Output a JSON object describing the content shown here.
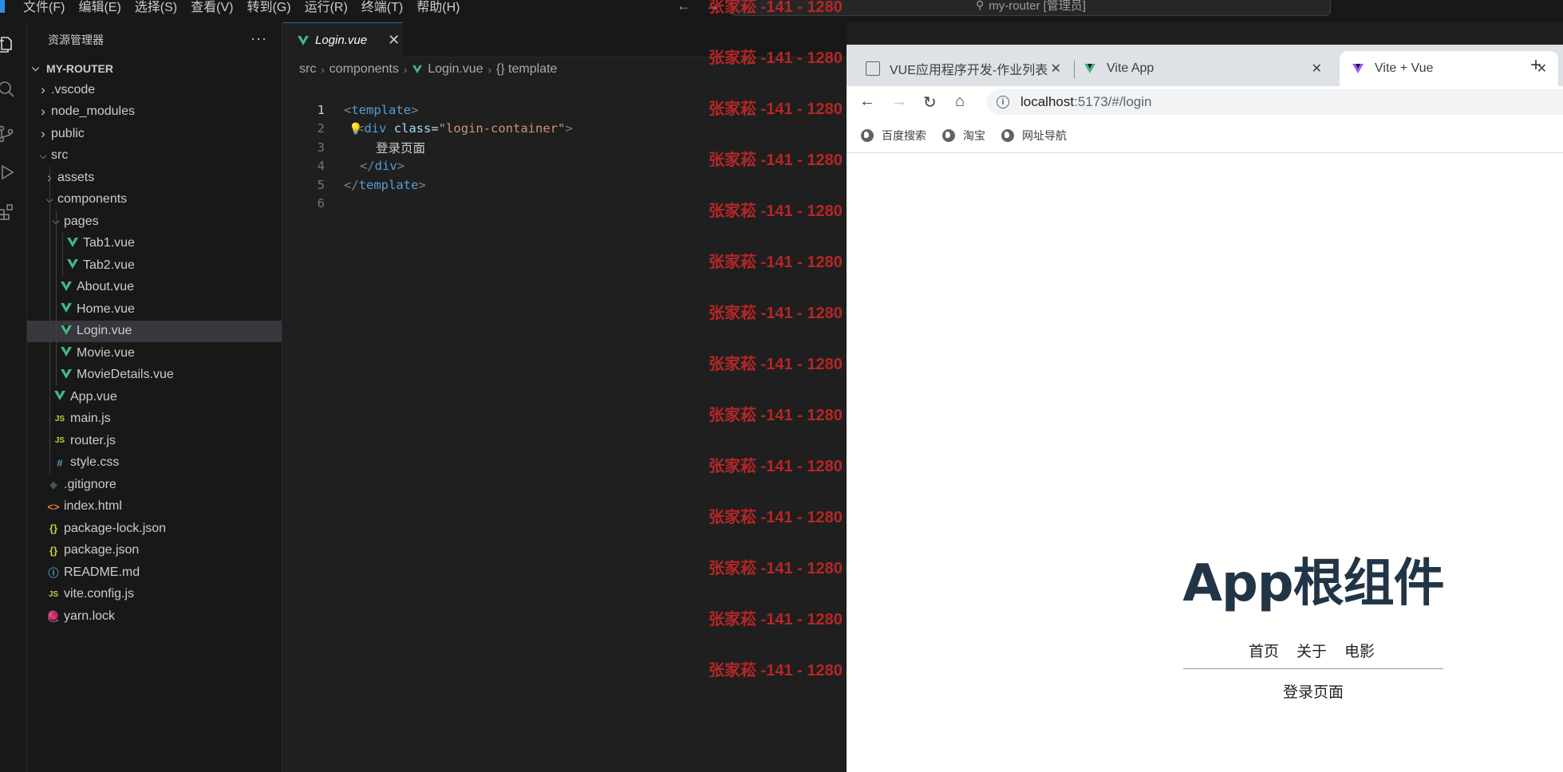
{
  "titlebar": {
    "menus": [
      "文件(F)",
      "编辑(E)",
      "选择(S)",
      "查看(V)",
      "转到(G)",
      "运行(R)",
      "终端(T)",
      "帮助(H)"
    ],
    "search": "my-router [管理员]"
  },
  "explorer": {
    "header": "资源管理器",
    "more": "···",
    "root": "MY-ROUTER",
    "items": [
      {
        "label": ".vscode",
        "icon": "chevron"
      },
      {
        "label": "node_modules",
        "icon": "chevron"
      },
      {
        "label": "public",
        "icon": "chevron"
      },
      {
        "label": "src",
        "icon": "chevron-open"
      },
      {
        "label": "assets",
        "icon": "chevron"
      },
      {
        "label": "components",
        "icon": "chevron-open"
      },
      {
        "label": "pages",
        "icon": "chevron-open"
      },
      {
        "label": "Tab1.vue",
        "icon": "vue"
      },
      {
        "label": "Tab2.vue",
        "icon": "vue"
      },
      {
        "label": "About.vue",
        "icon": "vue"
      },
      {
        "label": "Home.vue",
        "icon": "vue"
      },
      {
        "label": "Login.vue",
        "icon": "vue"
      },
      {
        "label": "Movie.vue",
        "icon": "vue"
      },
      {
        "label": "MovieDetails.vue",
        "icon": "vue"
      },
      {
        "label": "App.vue",
        "icon": "vue"
      },
      {
        "label": "main.js",
        "icon": "js"
      },
      {
        "label": "router.js",
        "icon": "js"
      },
      {
        "label": "style.css",
        "icon": "css"
      },
      {
        "label": ".gitignore",
        "icon": "git"
      },
      {
        "label": "index.html",
        "icon": "html"
      },
      {
        "label": "package-lock.json",
        "icon": "json"
      },
      {
        "label": "package.json",
        "icon": "json"
      },
      {
        "label": "README.md",
        "icon": "info"
      },
      {
        "label": "vite.config.js",
        "icon": "js"
      },
      {
        "label": "yarn.lock",
        "icon": "yarn"
      }
    ],
    "icon_glyphs": {
      "js": "JS",
      "css": "#",
      "git": "◆",
      "html": "<>",
      "json": "{}",
      "info": "ⓘ",
      "yarn": "🧶"
    },
    "icon_colors": {
      "js": "#cbcb41",
      "css": "#519aba",
      "git": "#41535b",
      "html": "#e37933",
      "json": "#cbcb41",
      "info": "#519aba",
      "yarn": "#519aba"
    }
  },
  "editor": {
    "tab": "Login.vue",
    "breadcrumb": [
      "src",
      "components",
      "Login.vue",
      "{} template"
    ],
    "line_numbers": [
      "1",
      "2",
      "3",
      "4",
      "5",
      "6"
    ],
    "code": {
      "l1_open": "<",
      "l1_tag": "template",
      "l1_close": ">",
      "l2_open": "<",
      "l2_tag": "div",
      "l2_attr": "class",
      "l2_eq": "=",
      "l2_str": "\"login-container\"",
      "l2_close": ">",
      "l3_text": "登录页面",
      "l4_open": "</",
      "l4_tag": "div",
      "l4_close": ">",
      "l5_open": "</",
      "l5_tag": "template",
      "l5_close": ">"
    }
  },
  "watermark": "张家菘 -141 - 1280",
  "browser": {
    "tabs": [
      {
        "title": "VUE应用程序开发-作业列表",
        "close": "✕"
      },
      {
        "title": "Vite App",
        "close": "✕"
      },
      {
        "title": "Vite + Vue",
        "close": "✕"
      }
    ],
    "new_tab": "+",
    "url_host": "localhost",
    "url_path": ":5173/#/login",
    "bookmarks": [
      "百度搜索",
      "淘宝",
      "网址导航"
    ],
    "page": {
      "title": "App根组件",
      "nav": [
        "首页",
        "关于",
        "电影"
      ],
      "content": "登录页面"
    }
  }
}
